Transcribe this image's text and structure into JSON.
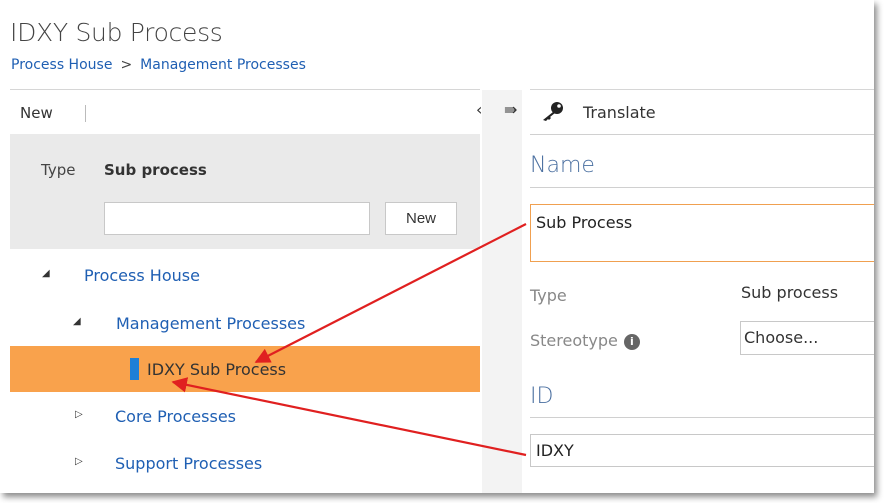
{
  "header": {
    "title": "IDXY Sub Process",
    "breadcrumb": [
      {
        "label": "Process House"
      },
      {
        "separator": ">"
      },
      {
        "label": "Management Processes"
      }
    ]
  },
  "left_toolbar": {
    "new_label": "New",
    "collapse_glyph": "‹",
    "expand_glyph": "⇛"
  },
  "filter": {
    "type_label": "Type",
    "type_value": "Sub process",
    "input_value": "",
    "new_button": "New"
  },
  "tree": [
    {
      "label": "Process House",
      "expanded": true
    },
    {
      "label": "Management Processes",
      "expanded": true
    },
    {
      "label": "IDXY Sub Process",
      "selected": true
    },
    {
      "label": "Core Processes",
      "expanded": false
    },
    {
      "label": "Support Processes",
      "expanded": false
    }
  ],
  "right_toolbar": {
    "translate_label": "Translate",
    "icon": "key-icon"
  },
  "details": {
    "name_heading": "Name",
    "name_value": "Sub Process",
    "type_label": "Type",
    "type_value": "Sub process",
    "stereotype_label": "Stereotype",
    "stereotype_value": "Choose...",
    "id_heading": "ID",
    "id_value": "IDXY"
  },
  "colors": {
    "selected_row": "#f9a24c",
    "link": "#1f5fb3",
    "annotation_arrow": "#e02020",
    "marker": "#1e7fd6"
  }
}
